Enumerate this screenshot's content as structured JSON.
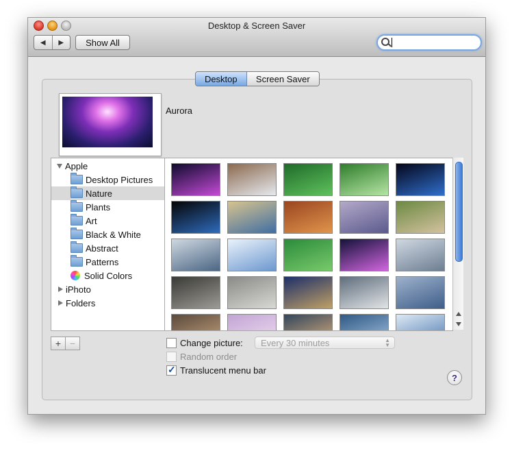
{
  "window": {
    "title": "Desktop & Screen Saver"
  },
  "toolbar": {
    "back_icon": "◀",
    "forward_icon": "▶",
    "show_all_label": "Show All",
    "search_value": ""
  },
  "tabs": [
    {
      "label": "Desktop",
      "active": true
    },
    {
      "label": "Screen Saver",
      "active": false
    }
  ],
  "preview": {
    "label": "Aurora"
  },
  "sidebar": {
    "items": [
      {
        "label": "Apple",
        "icon": "disclosure-down",
        "level": 0
      },
      {
        "label": "Desktop Pictures",
        "icon": "folder-icon",
        "level": 1
      },
      {
        "label": "Nature",
        "icon": "folder-icon",
        "level": 1,
        "selected": true
      },
      {
        "label": "Plants",
        "icon": "folder-icon",
        "level": 1
      },
      {
        "label": "Art",
        "icon": "folder-icon",
        "level": 1
      },
      {
        "label": "Black & White",
        "icon": "folder-icon",
        "level": 1
      },
      {
        "label": "Abstract",
        "icon": "folder-icon",
        "level": 1
      },
      {
        "label": "Patterns",
        "icon": "folder-icon",
        "level": 1
      },
      {
        "label": "Solid Colors",
        "icon": "color-wheel-icon",
        "level": 1
      },
      {
        "label": "iPhoto",
        "icon": "disclosure-right",
        "level": 0
      },
      {
        "label": "Folders",
        "icon": "disclosure-right",
        "level": 0
      }
    ]
  },
  "thumbnails": [
    {
      "name": "aurora-thumbnail",
      "colors": [
        "#0f0b2e",
        "#c54ad6"
      ]
    },
    {
      "name": "mountains-thumbnail",
      "colors": [
        "#8c6a4f",
        "#e5e9ef"
      ]
    },
    {
      "name": "ladybug-leaves-thumbnail",
      "colors": [
        "#1f6b2a",
        "#5fc15c"
      ]
    },
    {
      "name": "dew-drop-thumbnail",
      "colors": [
        "#2f7d2c",
        "#b6e5a4"
      ]
    },
    {
      "name": "earth-horizon-thumbnail",
      "colors": [
        "#05061a",
        "#2f6fcc"
      ]
    },
    {
      "name": "earth-thumbnail",
      "colors": [
        "#050505",
        "#2e6bbd"
      ]
    },
    {
      "name": "beach-thumbnail",
      "colors": [
        "#d7c38f",
        "#3f6ea3"
      ]
    },
    {
      "name": "sandstone-thumbnail",
      "colors": [
        "#9a4520",
        "#e0954c"
      ]
    },
    {
      "name": "dunes-thumbnail",
      "colors": [
        "#b3a9c9",
        "#5b5a8d"
      ]
    },
    {
      "name": "pagoda-thumbnail",
      "colors": [
        "#6c8a42",
        "#d4c1a0"
      ]
    },
    {
      "name": "calm-water-thumbnail",
      "colors": [
        "#cfd8e1",
        "#4b6684"
      ]
    },
    {
      "name": "ice-thumbnail",
      "colors": [
        "#eaf2fb",
        "#6c98cf"
      ]
    },
    {
      "name": "ladybug-thumbnail",
      "colors": [
        "#2a8b3a",
        "#79c96b"
      ]
    },
    {
      "name": "aurora-2-thumbnail",
      "colors": [
        "#14123a",
        "#d266df"
      ]
    },
    {
      "name": "reeds-thumbnail",
      "colors": [
        "#cfd8e2",
        "#6d7e92"
      ]
    },
    {
      "name": "zen-garden-thumbnail",
      "colors": [
        "#3a3a36",
        "#9c9b95"
      ]
    },
    {
      "name": "stones-thumbnail",
      "colors": [
        "#8a8a88",
        "#d8d8d4"
      ]
    },
    {
      "name": "leopard-thumbnail",
      "colors": [
        "#1d2f6a",
        "#c0a065"
      ]
    },
    {
      "name": "snow-leopard-thumbnail",
      "colors": [
        "#5f6e7d",
        "#e2e4e6"
      ]
    },
    {
      "name": "waves-thumbnail",
      "colors": [
        "#9db1cb",
        "#3f5e8a"
      ]
    },
    {
      "name": "pebbles-thumbnail",
      "colors": [
        "#5a4a3c",
        "#c9a47f"
      ]
    },
    {
      "name": "purple-peak-thumbnail",
      "colors": [
        "#c2a4d4",
        "#f0dff2"
      ]
    },
    {
      "name": "sunset-shore-thumbnail",
      "colors": [
        "#32465c",
        "#e2b27d"
      ]
    },
    {
      "name": "ocean-thumbnail",
      "colors": [
        "#2f5984",
        "#a7c4e3"
      ]
    },
    {
      "name": "sea-horizon-thumbnail",
      "colors": [
        "#dde9f5",
        "#4a77ad"
      ]
    }
  ],
  "options": {
    "change_picture": {
      "label": "Change picture:",
      "checked": false
    },
    "interval": "Every 30 minutes",
    "random_order": {
      "label": "Random order",
      "checked": false
    },
    "translucent_menu": {
      "label": "Translucent menu bar",
      "checked": true
    }
  },
  "bottom": {
    "add_label": "+",
    "remove_label": "−",
    "help_label": "?"
  }
}
